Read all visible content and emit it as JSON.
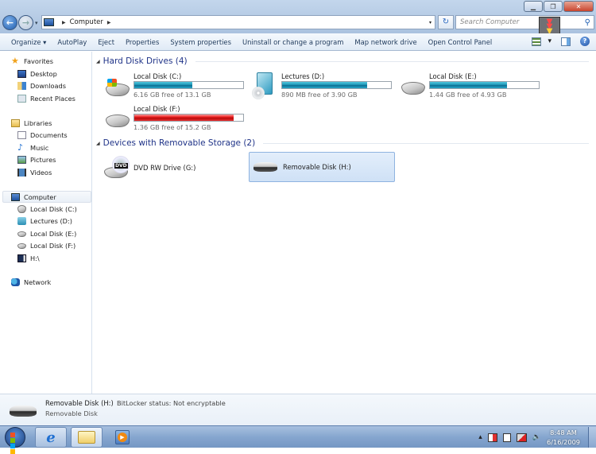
{
  "window": {
    "minimize_glyph": "▁",
    "restore_glyph": "❐",
    "close_glyph": "✕"
  },
  "nav": {
    "back_icon": "back-arrow-icon",
    "back_glyph": "←",
    "forward_glyph": "→",
    "history_glyph": "▾"
  },
  "address": {
    "path": [
      "Computer"
    ],
    "separator": "▶",
    "dropdown_glyph": "▾",
    "refresh_glyph": "↻"
  },
  "search": {
    "placeholder": "Search Computer",
    "icon_glyph": "⚲"
  },
  "toolbar": {
    "items": [
      "Organize ▾",
      "AutoPlay",
      "Eject",
      "Properties",
      "System properties",
      "Uninstall or change a program",
      "Map network drive",
      "Open Control Panel"
    ],
    "view_dropdown_glyph": "▾",
    "help_glyph": "?"
  },
  "sidebar": {
    "favorites": {
      "label": "Favorites",
      "items": [
        "Desktop",
        "Downloads",
        "Recent Places"
      ]
    },
    "libraries": {
      "label": "Libraries",
      "items": [
        "Documents",
        "Music",
        "Pictures",
        "Videos"
      ]
    },
    "computer": {
      "label": "Computer",
      "items": [
        "Local Disk (C:)",
        "Lectures (D:)",
        "Local Disk (E:)",
        "Local Disk (F:)",
        "H:\\"
      ]
    },
    "network": {
      "label": "Network"
    }
  },
  "main": {
    "hdd_group": {
      "label": "Hard Disk Drives (4)",
      "collapse_glyph": "◢"
    },
    "drives": [
      {
        "name": "Local Disk (C:)",
        "free_text": "6.16 GB free of 13.1 GB",
        "used_percent": 53,
        "status": "normal"
      },
      {
        "name": "Lectures (D:)",
        "free_text": "890 MB free of 3.90 GB",
        "used_percent": 78,
        "status": "normal"
      },
      {
        "name": "Local Disk (E:)",
        "free_text": "1.44 GB free of 4.93 GB",
        "used_percent": 71,
        "status": "normal"
      },
      {
        "name": "Local Disk (F:)",
        "free_text": "1.36 GB free of 15.2 GB",
        "used_percent": 91,
        "status": "low"
      }
    ],
    "removable_group": {
      "label": "Devices with Removable Storage (2)",
      "collapse_glyph": "◢"
    },
    "devices": [
      {
        "name": "DVD RW Drive (G:)",
        "badge": "DVD"
      },
      {
        "name": "Removable Disk (H:)",
        "selected": true
      }
    ]
  },
  "details": {
    "name": "Removable Disk (H:)",
    "bitlocker": "BitLocker status: Not encryptable",
    "type": "Removable Disk"
  },
  "taskbar": {
    "ie_glyph": "e",
    "wmp_glyph": "▶",
    "tray": {
      "expand_glyph": "▴",
      "volume_glyph": "🔈"
    },
    "time": "8:48 AM",
    "date": "6/16/2009"
  },
  "colors": {
    "accent_bar": "#26a0c0",
    "low_space_bar": "#e22222",
    "group_header": "#1e3287"
  }
}
